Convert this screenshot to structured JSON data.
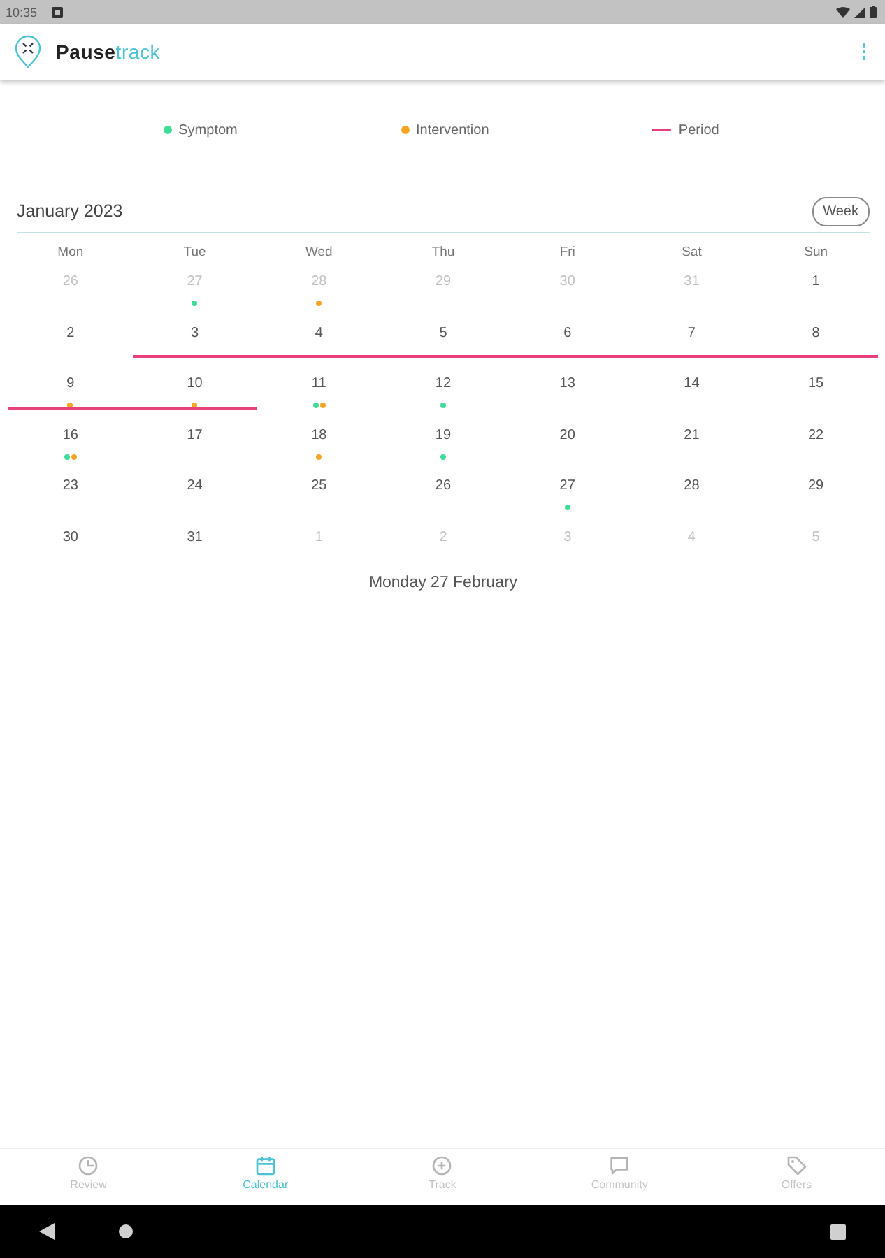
{
  "status_bar": {
    "time": "10:35"
  },
  "app_bar": {
    "title_parts": [
      {
        "text": "Pause",
        "accent": false
      },
      {
        "text": "track",
        "accent": true
      }
    ]
  },
  "legend": [
    {
      "label": "Symptom",
      "kind": "dot",
      "color": "#3ddc97"
    },
    {
      "label": "Intervention",
      "kind": "dot",
      "color": "#f5a524"
    },
    {
      "label": "Period",
      "kind": "line",
      "color": "#e8407a"
    }
  ],
  "calendar": {
    "month": "January 2023",
    "view_button": "Week",
    "weekdays": [
      "Mon",
      "Tue",
      "Wed",
      "Thu",
      "Fri",
      "Sat",
      "Sun"
    ],
    "weeks": [
      [
        {
          "day": "26",
          "other_month": true,
          "period": false
        },
        {
          "day": "27",
          "other_month": true,
          "period": false,
          "markers": [
            {
              "color": "#3ddc97"
            }
          ]
        },
        {
          "day": "28",
          "other_month": true,
          "period": false,
          "markers": [
            {
              "color": "#f5a524"
            }
          ]
        },
        {
          "day": "29",
          "other_month": true,
          "period": false
        },
        {
          "day": "30",
          "other_month": true,
          "period": false
        },
        {
          "day": "31",
          "other_month": true,
          "period": false
        },
        {
          "day": "1",
          "other_month": false,
          "period": false
        }
      ],
      [
        {
          "day": "2",
          "other_month": false,
          "period": false
        },
        {
          "day": "3",
          "other_month": false,
          "period": true
        },
        {
          "day": "4",
          "other_month": false,
          "period": true
        },
        {
          "day": "5",
          "other_month": false,
          "period": true
        },
        {
          "day": "6",
          "other_month": false,
          "period": true
        },
        {
          "day": "7",
          "other_month": false,
          "period": true
        },
        {
          "day": "8",
          "other_month": false,
          "period": true
        }
      ],
      [
        {
          "day": "9",
          "other_month": false,
          "period": true,
          "markers": [
            {
              "color": "#f5a524"
            }
          ]
        },
        {
          "day": "10",
          "other_month": false,
          "period": true,
          "markers": [
            {
              "color": "#f5a524"
            }
          ]
        },
        {
          "day": "11",
          "other_month": false,
          "period": false,
          "markers": [
            {
              "color": "#3ddc97"
            },
            {
              "color": "#f5a524"
            }
          ]
        },
        {
          "day": "12",
          "other_month": false,
          "period": false,
          "markers": [
            {
              "color": "#3ddc97"
            }
          ]
        },
        {
          "day": "13",
          "other_month": false,
          "period": false
        },
        {
          "day": "14",
          "other_month": false,
          "period": false
        },
        {
          "day": "15",
          "other_month": false,
          "period": false
        }
      ],
      [
        {
          "day": "16",
          "other_month": false,
          "period": false,
          "markers": [
            {
              "color": "#3ddc97"
            },
            {
              "color": "#f5a524"
            }
          ]
        },
        {
          "day": "17",
          "other_month": false,
          "period": false
        },
        {
          "day": "18",
          "other_month": false,
          "period": false,
          "markers": [
            {
              "color": "#f5a524"
            }
          ]
        },
        {
          "day": "19",
          "other_month": false,
          "period": false,
          "markers": [
            {
              "color": "#3ddc97"
            }
          ]
        },
        {
          "day": "20",
          "other_month": false,
          "period": false
        },
        {
          "day": "21",
          "other_month": false,
          "period": false
        },
        {
          "day": "22",
          "other_month": false,
          "period": false
        }
      ],
      [
        {
          "day": "23",
          "other_month": false,
          "period": false
        },
        {
          "day": "24",
          "other_month": false,
          "period": false
        },
        {
          "day": "25",
          "other_month": false,
          "period": false
        },
        {
          "day": "26",
          "other_month": false,
          "period": false
        },
        {
          "day": "27",
          "other_month": false,
          "period": false,
          "markers": [
            {
              "color": "#3ddc97"
            }
          ]
        },
        {
          "day": "28",
          "other_month": false,
          "period": false
        },
        {
          "day": "29",
          "other_month": false,
          "period": false
        }
      ],
      [
        {
          "day": "30",
          "other_month": false,
          "period": false
        },
        {
          "day": "31",
          "other_month": false,
          "period": false
        },
        {
          "day": "1",
          "other_month": true,
          "period": false
        },
        {
          "day": "2",
          "other_month": true,
          "period": false
        },
        {
          "day": "3",
          "other_month": true,
          "period": false
        },
        {
          "day": "4",
          "other_month": true,
          "period": false
        },
        {
          "day": "5",
          "other_month": true,
          "period": false
        }
      ]
    ]
  },
  "selected_date": "Monday 27 February",
  "bottom_nav": [
    {
      "label": "Review",
      "selected": false
    },
    {
      "label": "Calendar",
      "selected": true
    },
    {
      "label": "Track",
      "selected": false
    },
    {
      "label": "Community",
      "selected": false
    },
    {
      "label": "Offers",
      "selected": false
    }
  ]
}
